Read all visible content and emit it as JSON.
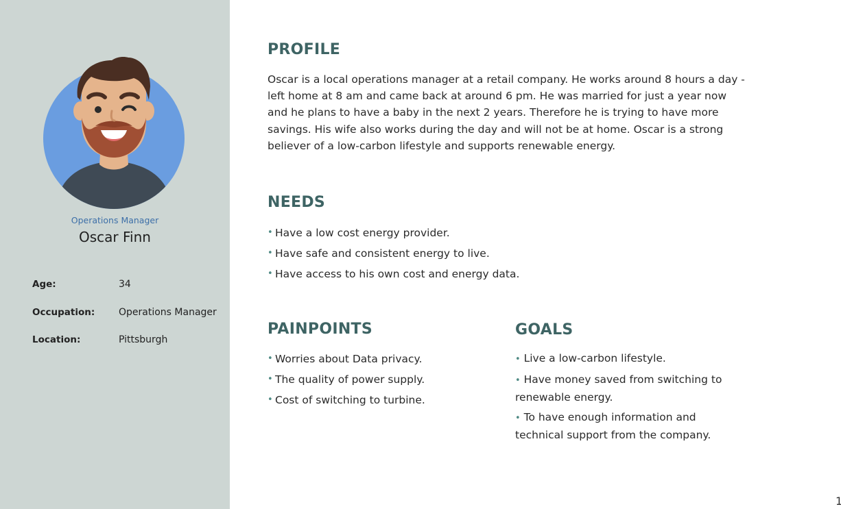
{
  "persona": {
    "role": "Operations Manager",
    "name": "Oscar Finn",
    "details": [
      {
        "label": "Age:",
        "value": "34"
      },
      {
        "label": "Occupation:",
        "value": "Operations Manager"
      },
      {
        "label": "Location:",
        "value": "Pittsburgh"
      }
    ]
  },
  "profile": {
    "heading": "PROFILE",
    "text": "Oscar is a local operations manager at a retail company. He works around 8 hours a day - left home at 8 am and came back at around 6 pm. He was married for just a year now and he plans to have a baby in the next 2 years. Therefore he is trying to have more savings. His wife also works during the day and will not be at home. Oscar is a strong believer of a low-carbon lifestyle and supports renewable energy."
  },
  "needs": {
    "heading": "NEEDS",
    "items": [
      "Have a low cost energy provider.",
      "Have safe and consistent energy to live.",
      "Have access to his own cost and energy data."
    ]
  },
  "painpoints": {
    "heading": "PAINPOINTS",
    "items": [
      "Worries about Data privacy.",
      "The quality of power supply.",
      "Cost of switching to turbine."
    ]
  },
  "goals": {
    "heading": "GOALS",
    "items": [
      "Live a low-carbon lifestyle.",
      "Have money saved from switching to renewable energy.",
      " To have enough information and technical support from the company."
    ]
  },
  "bullet": "•",
  "page_number": "1",
  "colors": {
    "sidebar_bg": "#cdd6d3",
    "heading": "#3e6464",
    "role_text": "#3d6fa8",
    "avatar_circle": "#6a9de0",
    "bullet": "#4f8a84"
  },
  "icons": {
    "avatar": "man-with-beard-winking-avatar"
  }
}
